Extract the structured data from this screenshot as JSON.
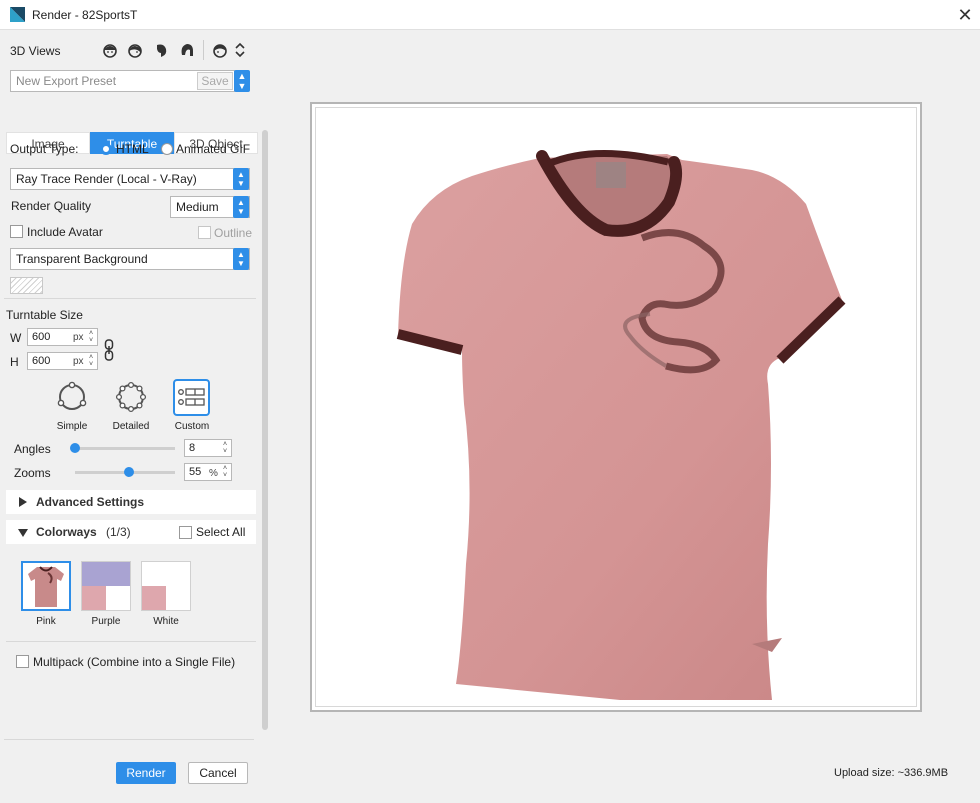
{
  "window": {
    "title": "Render - 82SportsT",
    "close_glyph": "✕"
  },
  "views": {
    "label": "3D Views",
    "icons": [
      "front-view-icon",
      "three-quarter-view-icon",
      "side-view-icon",
      "back-three-quarter-view-icon",
      "back-view-icon"
    ]
  },
  "preset": {
    "placeholder": "New Export Preset",
    "save_label": "Save"
  },
  "tabs": [
    {
      "label": "Image"
    },
    {
      "label": "Turntable"
    },
    {
      "label": "3D Object"
    }
  ],
  "output": {
    "label": "Output Type:",
    "option_html": "HTML",
    "option_gif": "Animated GIF",
    "selected": "HTML"
  },
  "render_engine": {
    "value": "Ray Trace Render (Local - V-Ray)"
  },
  "quality": {
    "label": "Render Quality",
    "value": "Medium"
  },
  "include_avatar": {
    "label": "Include Avatar",
    "checked": false
  },
  "outline": {
    "label": "Outline",
    "checked": false,
    "disabled": true
  },
  "background": {
    "value": "Transparent Background"
  },
  "turntable_size": {
    "label": "Turntable Size",
    "w_label": "W",
    "w_value": "600",
    "w_unit": "px",
    "h_label": "H",
    "h_value": "600",
    "h_unit": "px"
  },
  "modes": [
    {
      "label": "Simple"
    },
    {
      "label": "Detailed"
    },
    {
      "label": "Custom"
    }
  ],
  "selected_mode": "Custom",
  "angles": {
    "label": "Angles",
    "value": "8",
    "slider_fraction": 0.0
  },
  "zooms": {
    "label": "Zooms",
    "value": "55",
    "unit": "%",
    "slider_fraction": 0.55
  },
  "advanced": {
    "label": "Advanced Settings"
  },
  "colorways": {
    "label": "Colorways",
    "count": "(1/3)",
    "select_all_label": "Select All"
  },
  "swatches": [
    {
      "label": "Pink",
      "selected": true
    },
    {
      "label": "Purple",
      "selected": false
    },
    {
      "label": "White",
      "selected": false
    }
  ],
  "multipack": {
    "label": "Multipack (Combine into a Single File)",
    "checked": false
  },
  "buttons": {
    "render": "Render",
    "cancel": "Cancel"
  },
  "upload_size": "Upload size: ~336.9MB",
  "colors": {
    "accent": "#2e8ee8",
    "shirt": "#d99a9a",
    "trim": "#4a1f1f"
  }
}
